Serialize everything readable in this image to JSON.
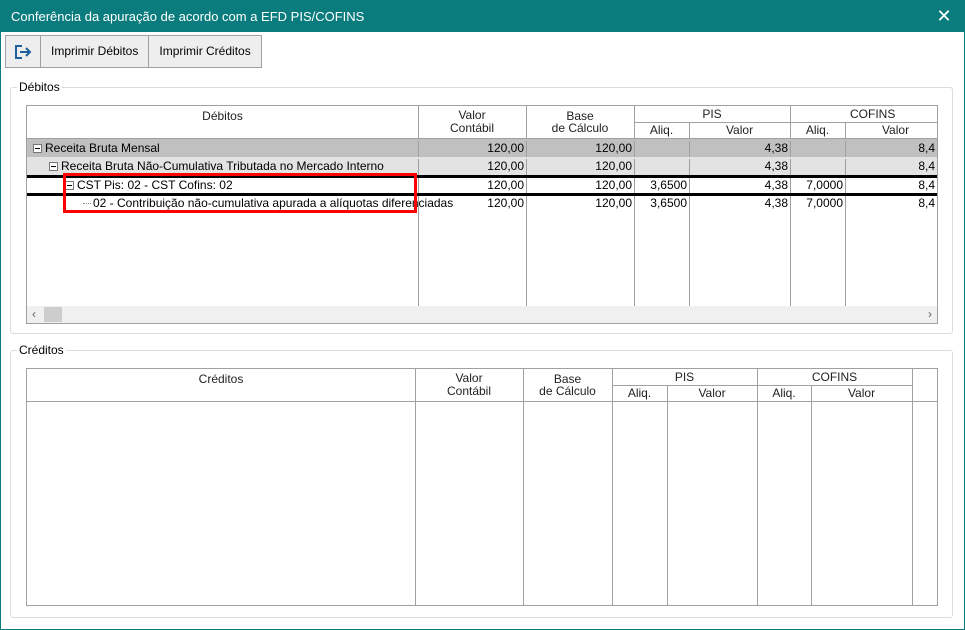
{
  "window": {
    "title": "Conferência da apuração de acordo com a EFD PIS/COFINS",
    "close_icon": "close-icon"
  },
  "toolbar": {
    "exit_icon": "exit-icon",
    "print_debits": "Imprimir Débitos",
    "print_credits": "Imprimir Créditos"
  },
  "debits": {
    "group_label": "Débitos",
    "headers": {
      "tree": "Débitos",
      "valor_contabil_1": "Valor",
      "valor_contabil_2": "Contábil",
      "base_1": "Base",
      "base_2": "de Cálculo",
      "pis": "PIS",
      "cofins": "COFINS",
      "aliq": "Aliq.",
      "valor": "Valor"
    },
    "rows": [
      {
        "label": "Receita Bruta Mensal",
        "valor_contabil": "120,00",
        "base": "120,00",
        "pis_aliq": "",
        "pis_valor": "4,38",
        "cofins_aliq": "",
        "cofins_valor": "8,4"
      },
      {
        "label": "Receita Bruta Não-Cumulativa Tributada no Mercado Interno",
        "valor_contabil": "120,00",
        "base": "120,00",
        "pis_aliq": "",
        "pis_valor": "4,38",
        "cofins_aliq": "",
        "cofins_valor": "8,4"
      },
      {
        "label": "CST Pis: 02 - CST Cofins: 02",
        "valor_contabil": "120,00",
        "base": "120,00",
        "pis_aliq": "3,6500",
        "pis_valor": "4,38",
        "cofins_aliq": "7,0000",
        "cofins_valor": "8,4"
      },
      {
        "label": "02 - Contribuição não-cumulativa apurada a alíquotas diferenciadas",
        "valor_contabil": "120,00",
        "base": "120,00",
        "pis_aliq": "3,6500",
        "pis_valor": "4,38",
        "cofins_aliq": "7,0000",
        "cofins_valor": "8,4"
      }
    ]
  },
  "credits": {
    "group_label": "Créditos",
    "headers": {
      "tree": "Créditos",
      "valor_contabil_1": "Valor",
      "valor_contabil_2": "Contábil",
      "base_1": "Base",
      "base_2": "de Cálculo",
      "pis": "PIS",
      "cofins": "COFINS",
      "aliq": "Aliq.",
      "valor": "Valor"
    }
  },
  "colors": {
    "titlebar": "#0b7c7e",
    "highlight_box": "#ff0000",
    "row_level0": "#c0c0c0",
    "row_level1": "#e3e3e3"
  }
}
